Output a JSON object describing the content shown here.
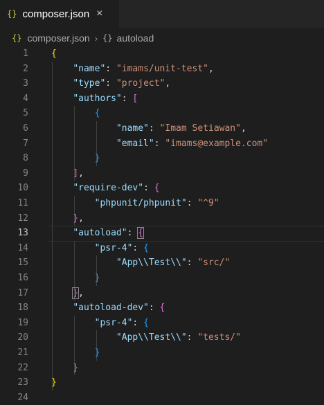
{
  "tab": {
    "icon": "{}",
    "label": "composer.json",
    "close_icon": "×"
  },
  "breadcrumb": {
    "icon": "{}",
    "file": "composer.json",
    "separator": "›",
    "symbol_icon": "{}",
    "symbol": "autoload"
  },
  "editor": {
    "active_line": 13,
    "line_numbers": [
      "1",
      "2",
      "3",
      "4",
      "5",
      "6",
      "7",
      "8",
      "9",
      "10",
      "11",
      "12",
      "13",
      "14",
      "15",
      "16",
      "17",
      "18",
      "19",
      "20",
      "21",
      "22",
      "23",
      "24"
    ],
    "lines": [
      [
        {
          "t": "{",
          "c": "b1"
        }
      ],
      [
        {
          "t": "    "
        },
        {
          "t": "\"name\"",
          "c": "k"
        },
        {
          "t": ": ",
          "c": "p"
        },
        {
          "t": "\"imams/unit-test\"",
          "c": "s"
        },
        {
          "t": ",",
          "c": "p"
        }
      ],
      [
        {
          "t": "    "
        },
        {
          "t": "\"type\"",
          "c": "k"
        },
        {
          "t": ": ",
          "c": "p"
        },
        {
          "t": "\"project\"",
          "c": "s"
        },
        {
          "t": ",",
          "c": "p"
        }
      ],
      [
        {
          "t": "    "
        },
        {
          "t": "\"authors\"",
          "c": "k"
        },
        {
          "t": ": ",
          "c": "p"
        },
        {
          "t": "[",
          "c": "b2"
        }
      ],
      [
        {
          "t": "        "
        },
        {
          "t": "{",
          "c": "b3"
        }
      ],
      [
        {
          "t": "            "
        },
        {
          "t": "\"name\"",
          "c": "k"
        },
        {
          "t": ": ",
          "c": "p"
        },
        {
          "t": "\"Imam Setiawan\"",
          "c": "s"
        },
        {
          "t": ",",
          "c": "p"
        }
      ],
      [
        {
          "t": "            "
        },
        {
          "t": "\"email\"",
          "c": "k"
        },
        {
          "t": ": ",
          "c": "p"
        },
        {
          "t": "\"imams@example.com\"",
          "c": "s"
        }
      ],
      [
        {
          "t": "        "
        },
        {
          "t": "}",
          "c": "b3"
        }
      ],
      [
        {
          "t": "    "
        },
        {
          "t": "]",
          "c": "b2"
        },
        {
          "t": ",",
          "c": "p"
        }
      ],
      [
        {
          "t": "    "
        },
        {
          "t": "\"require-dev\"",
          "c": "k"
        },
        {
          "t": ": ",
          "c": "p"
        },
        {
          "t": "{",
          "c": "b2"
        }
      ],
      [
        {
          "t": "        "
        },
        {
          "t": "\"phpunit/phpunit\"",
          "c": "k"
        },
        {
          "t": ": ",
          "c": "p"
        },
        {
          "t": "\"^9\"",
          "c": "s"
        }
      ],
      [
        {
          "t": "    "
        },
        {
          "t": "}",
          "c": "b2"
        },
        {
          "t": ",",
          "c": "p"
        }
      ],
      [
        {
          "t": "    "
        },
        {
          "t": "\"autoload\"",
          "c": "k"
        },
        {
          "t": ": ",
          "c": "p"
        },
        {
          "t": "{",
          "c": "b2 match"
        }
      ],
      [
        {
          "t": "        "
        },
        {
          "t": "\"psr-4\"",
          "c": "k"
        },
        {
          "t": ": ",
          "c": "p"
        },
        {
          "t": "{",
          "c": "b3"
        }
      ],
      [
        {
          "t": "            "
        },
        {
          "t": "\"App\\\\Test\\\\\"",
          "c": "k"
        },
        {
          "t": ": ",
          "c": "p"
        },
        {
          "t": "\"src/\"",
          "c": "s"
        }
      ],
      [
        {
          "t": "        "
        },
        {
          "t": "}",
          "c": "b3"
        }
      ],
      [
        {
          "t": "    "
        },
        {
          "t": "}",
          "c": "b2 match"
        },
        {
          "t": ",",
          "c": "p"
        }
      ],
      [
        {
          "t": "    "
        },
        {
          "t": "\"autoload-dev\"",
          "c": "k"
        },
        {
          "t": ": ",
          "c": "p"
        },
        {
          "t": "{",
          "c": "b2"
        }
      ],
      [
        {
          "t": "        "
        },
        {
          "t": "\"psr-4\"",
          "c": "k"
        },
        {
          "t": ": ",
          "c": "p"
        },
        {
          "t": "{",
          "c": "b3"
        }
      ],
      [
        {
          "t": "            "
        },
        {
          "t": "\"App\\\\Test\\\\\"",
          "c": "k"
        },
        {
          "t": ": ",
          "c": "p"
        },
        {
          "t": "\"tests/\"",
          "c": "s"
        }
      ],
      [
        {
          "t": "        "
        },
        {
          "t": "}",
          "c": "b3"
        }
      ],
      [
        {
          "t": "    "
        },
        {
          "t": "}",
          "c": "b2"
        }
      ],
      [
        {
          "t": "}",
          "c": "b1"
        }
      ],
      []
    ]
  },
  "colors": {
    "background": "#1e1e1e",
    "key": "#9cdcfe",
    "string": "#ce9178",
    "bracket_level1": "#ffd700",
    "bracket_level2": "#da70d6",
    "bracket_level3": "#179fff"
  }
}
